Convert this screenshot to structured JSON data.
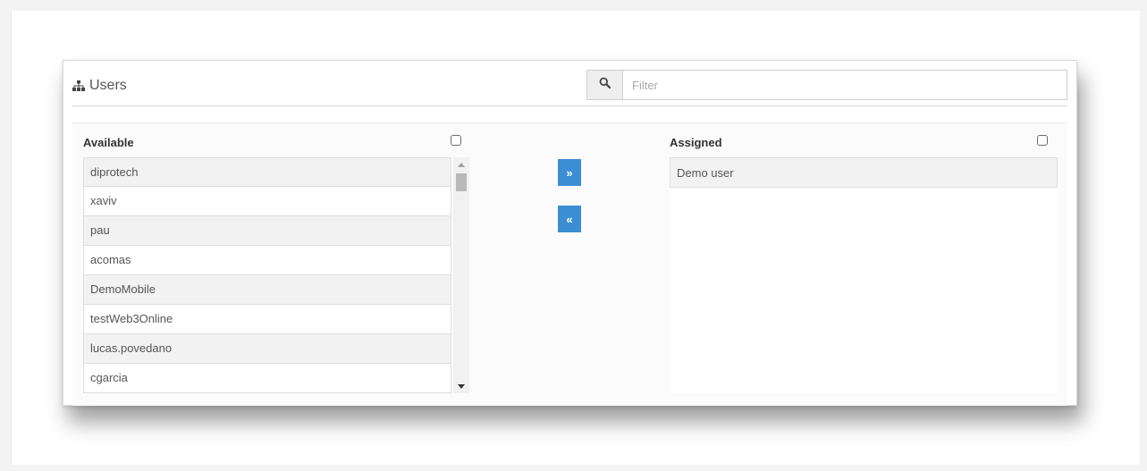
{
  "header": {
    "title": "Users",
    "title_icon": "sitemap-icon",
    "filter": {
      "placeholder": "Filter",
      "value": "",
      "icon": "search-icon"
    }
  },
  "available": {
    "title": "Available",
    "items": [
      "diprotech",
      "xaviv",
      "pau",
      "acomas",
      "DemoMobile",
      "testWeb3Online",
      "lucas.povedano",
      "cgarcia"
    ]
  },
  "assigned": {
    "title": "Assigned",
    "items": [
      "Demo user"
    ]
  },
  "buttons": {
    "move_right_label": "»",
    "move_left_label": "«",
    "accent": "#3b8ed4"
  }
}
